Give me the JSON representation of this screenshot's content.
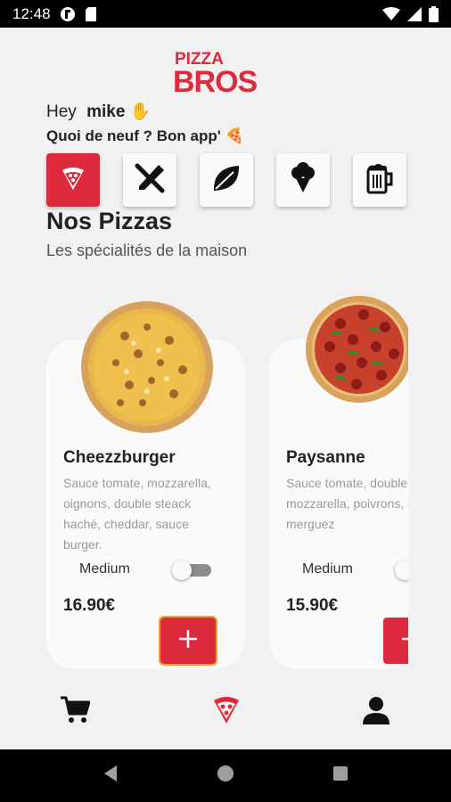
{
  "status_bar": {
    "time": "12:48",
    "icons": [
      "pizza-app-notification-icon",
      "sd-card-icon",
      "wifi-icon",
      "signal-icon",
      "battery-icon"
    ]
  },
  "logo": {
    "line1": "PIZZA",
    "line2": "BROS"
  },
  "greeting": {
    "hey": "Hey",
    "name": "mike",
    "wave_emoji": "✋",
    "subtitle": "Quoi de neuf ?  Bon app'",
    "pizza_emoji": "🍕"
  },
  "categories": [
    {
      "name": "pizza",
      "active": true
    },
    {
      "name": "plats",
      "active": false
    },
    {
      "name": "salades",
      "active": false
    },
    {
      "name": "desserts",
      "active": false
    },
    {
      "name": "boissons",
      "active": false
    }
  ],
  "section": {
    "title": "Nos Pizzas",
    "subtitle": "Les spécialités de la maison"
  },
  "pizzas": [
    {
      "name": "Cheezzburger",
      "description": "Sauce tomate, mozzarella, oignons, double steack haché, cheddar, sauce burger.",
      "size_label": "Medium",
      "size_toggle": false,
      "price": "16.90€",
      "add_label": "+"
    },
    {
      "name": "Paysanne",
      "description": "Sauce tomate, double mozzarella, poivrons, chorizo, merguez",
      "size_label": "Medium",
      "size_toggle": false,
      "price": "15.90€",
      "add_label": "+"
    }
  ],
  "bottom_nav": [
    "cart",
    "pizza",
    "profile"
  ],
  "colors": {
    "accent": "#dd2a3c",
    "background": "#f1f1f1",
    "card": "#fafafa",
    "text": "#222222",
    "muted": "#9a9a9a"
  }
}
